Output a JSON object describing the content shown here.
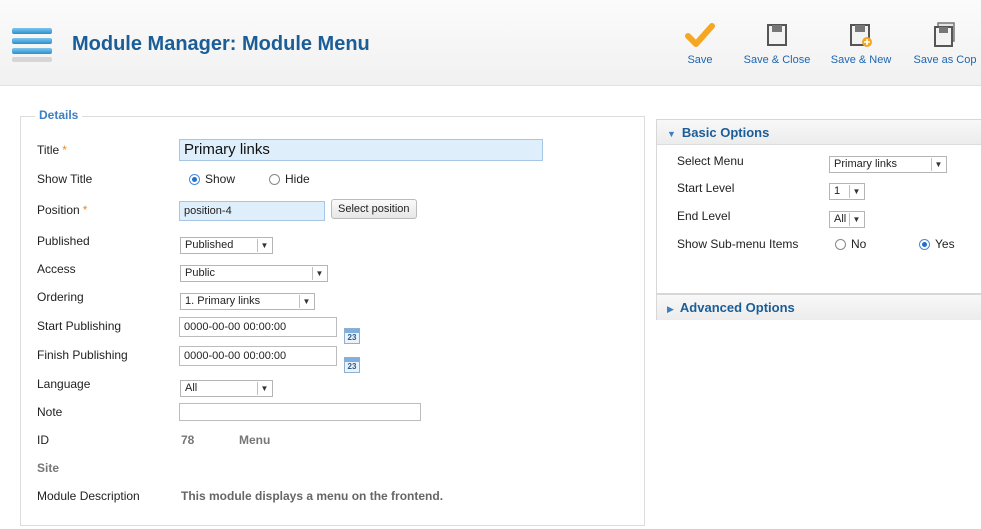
{
  "header": {
    "title": "Module Manager: Module Menu",
    "toolbar": [
      {
        "label": "Save",
        "icon": "checkmark-icon"
      },
      {
        "label": "Save & Close",
        "icon": "save-close-icon"
      },
      {
        "label": "Save & New",
        "icon": "save-new-icon"
      },
      {
        "label": "Save as Cop",
        "icon": "save-copy-icon"
      }
    ]
  },
  "details": {
    "legend": "Details",
    "title_label": "Title",
    "title_value": "Primary links",
    "show_title_label": "Show Title",
    "show_option": "Show",
    "hide_option": "Hide",
    "position_label": "Position",
    "position_value": "position-4",
    "select_position_button": "Select position",
    "published_label": "Published",
    "published_value": "Published",
    "access_label": "Access",
    "access_value": "Public",
    "ordering_label": "Ordering",
    "ordering_value": "1. Primary links",
    "start_publishing_label": "Start Publishing",
    "start_publishing_value": "0000-00-00 00:00:00",
    "finish_publishing_label": "Finish Publishing",
    "finish_publishing_value": "0000-00-00 00:00:00",
    "calendar_day": "23",
    "language_label": "Language",
    "language_value": "All",
    "note_label": "Note",
    "note_value": "",
    "id_label": "ID",
    "id_value": "78",
    "type_value": "Menu",
    "site_label": "Site",
    "module_description_label": "Module Description",
    "module_description_value": "This module displays a menu on the frontend."
  },
  "basic_options": {
    "heading": "Basic Options",
    "select_menu_label": "Select Menu",
    "select_menu_value": "Primary links",
    "start_level_label": "Start Level",
    "start_level_value": "1",
    "end_level_label": "End Level",
    "end_level_value": "All",
    "show_submenu_label": "Show Sub-menu Items",
    "no_option": "No",
    "yes_option": "Yes"
  },
  "advanced_options": {
    "heading": "Advanced Options"
  },
  "colors": {
    "title": "#1b5d97",
    "link": "#1e66b0",
    "required": "#f08a18",
    "save_check": "#f5a623"
  }
}
